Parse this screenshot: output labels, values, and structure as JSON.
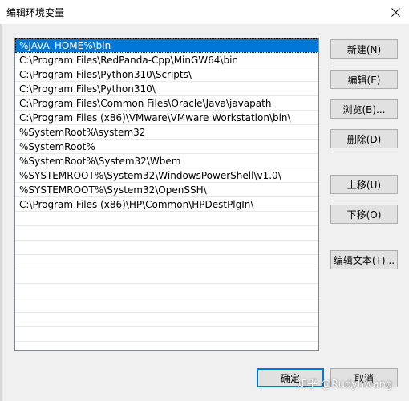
{
  "window": {
    "title": "编辑环境变量",
    "close_icon": "close-icon"
  },
  "paths": [
    "%JAVA_HOME%\\bin",
    "C:\\Program Files\\RedPanda-Cpp\\MinGW64\\bin",
    "C:\\Program Files\\Python310\\Scripts\\",
    "C:\\Program Files\\Python310\\",
    "C:\\Program Files\\Common Files\\Oracle\\Java\\javapath",
    "C:\\Program Files (x86)\\VMware\\VMware Workstation\\bin\\",
    "%SystemRoot%\\system32",
    "%SystemRoot%",
    "%SystemRoot%\\System32\\Wbem",
    "%SYSTEMROOT%\\System32\\WindowsPowerShell\\v1.0\\",
    "%SYSTEMROOT%\\System32\\OpenSSH\\",
    "C:\\Program Files (x86)\\HP\\Common\\HPDestPlgIn\\"
  ],
  "selected_index": 0,
  "buttons": {
    "new": "新建(N)",
    "edit": "编辑(E)",
    "browse": "浏览(B)...",
    "delete": "删除(D)",
    "move_up": "上移(U)",
    "move_down": "下移(O)",
    "edit_text": "编辑文本(T)...",
    "ok": "确定",
    "cancel": "取消"
  },
  "watermark": "知乎 @Rudyhwang",
  "colors": {
    "selection": "#0078d7",
    "default_button_border": "#0078d7"
  }
}
